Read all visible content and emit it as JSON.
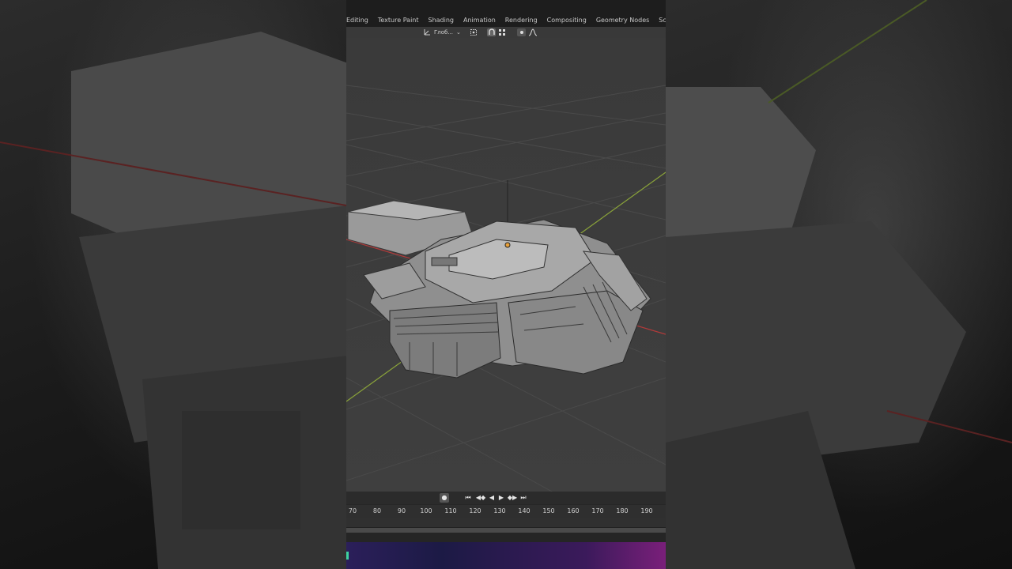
{
  "workspace_tabs": [
    "Editing",
    "Texture Paint",
    "Shading",
    "Animation",
    "Rendering",
    "Compositing",
    "Geometry Nodes",
    "Scripting"
  ],
  "tab_add_label": "+",
  "header": {
    "transform_orientation": "Глоб...",
    "dropdown_glyph": "⌄"
  },
  "playback": {
    "record": "●",
    "jump_start": "⏮",
    "prev_key": "◀◆",
    "play_reverse": "◀",
    "play": "▶",
    "next_key": "◆▶",
    "jump_end": "⏭"
  },
  "timeline": {
    "frame_ticks": [
      "70",
      "80",
      "90",
      "100",
      "110",
      "120",
      "130",
      "140",
      "150",
      "160",
      "170",
      "180",
      "190"
    ]
  },
  "colors": {
    "accent_keyframe": "#3ed3a0",
    "x_axis": "#b33a3a",
    "y_axis": "#8aa33a",
    "grid": "#4a4a4a"
  }
}
